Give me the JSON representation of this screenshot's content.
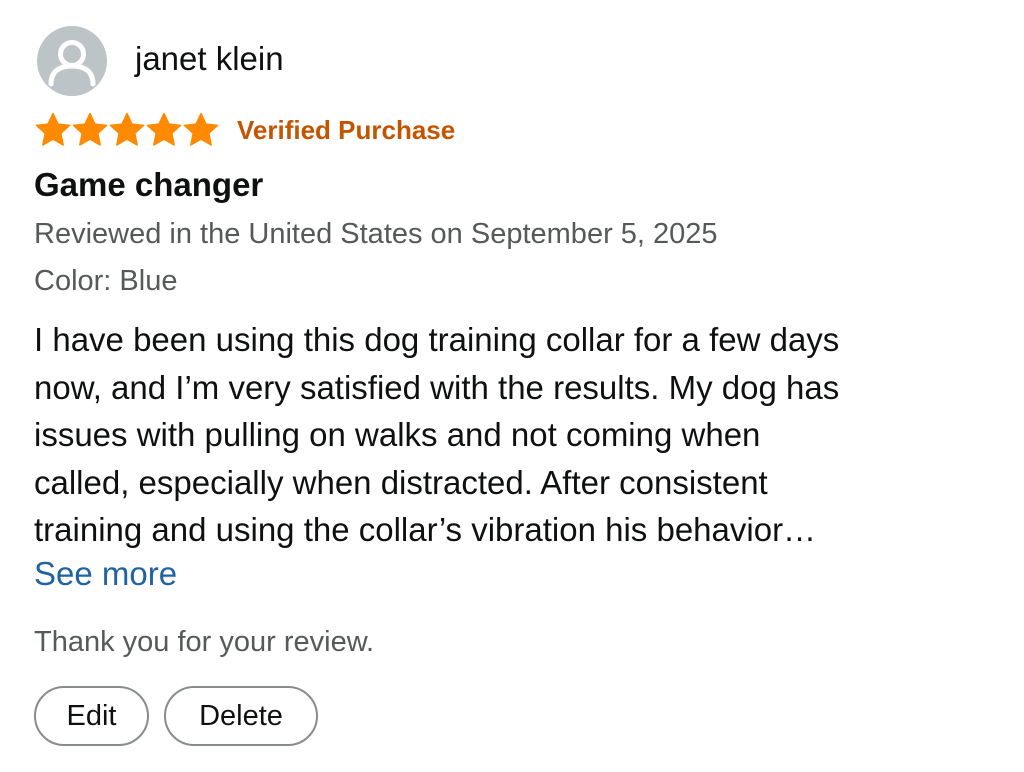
{
  "reviewer": {
    "name": "janet klein",
    "avatar_icon": "default-user-avatar-icon",
    "avatar_color": "#bdc4c7"
  },
  "rating": {
    "stars": 5,
    "max_stars": 5,
    "star_color": "#ff8a00",
    "star_icon": "star-icon"
  },
  "verified_label": "Verified Purchase",
  "review": {
    "title": "Game changer",
    "date_line": "Reviewed in the United States on September 5, 2025",
    "variant_line": "Color: Blue",
    "body_lines": [
      "I have been using this dog training collar for a few days",
      "now, and I’m very satisfied with the results. My dog has",
      "issues with pulling on walks and not coming when",
      "called, especially when distracted. After consistent",
      "training and using the collar’s vibration his behavior…"
    ],
    "see_more_label": "See more"
  },
  "footer": {
    "thanks_text": "Thank you for your review.",
    "edit_label": "Edit",
    "delete_label": "Delete"
  },
  "colors": {
    "verified": "#c45500",
    "link": "#2162a1",
    "secondary_text": "#565959"
  }
}
